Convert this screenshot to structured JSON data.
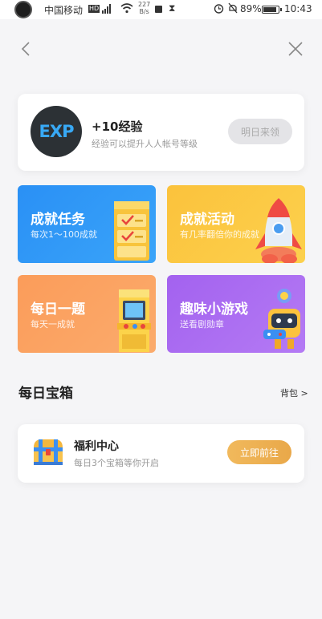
{
  "status_bar": {
    "carrier": "中国移动",
    "network": "HD",
    "speed_value": "227",
    "speed_unit": "B/s",
    "battery": "89%",
    "battery_level": 0.89,
    "time": "10:43"
  },
  "nav": {
    "back_icon": "back-chevron-icon",
    "close_icon": "close-x-icon"
  },
  "exp_card": {
    "badge": "EXP",
    "title": "+10经验",
    "subtitle": "经验可以提升人人帐号等级",
    "button": "明日来领"
  },
  "tiles": [
    {
      "title": "成就任务",
      "subtitle": "每次1～100成就",
      "color": "#2a90f5"
    },
    {
      "title": "成就活动",
      "subtitle": "有几率翻倍你的成就",
      "color": "#fbc23c"
    },
    {
      "title": "每日一题",
      "subtitle": "每天一成就",
      "color": "#fb9c5a"
    },
    {
      "title": "趣味小游戏",
      "subtitle": "送看剧勋章",
      "color": "#a362ef"
    }
  ],
  "daily_chest": {
    "section_title": "每日宝箱",
    "backpack_link": "背包 >"
  },
  "welfare_card": {
    "title": "福利中心",
    "subtitle": "每日3个宝箱等你开启",
    "button": "立即前往"
  }
}
